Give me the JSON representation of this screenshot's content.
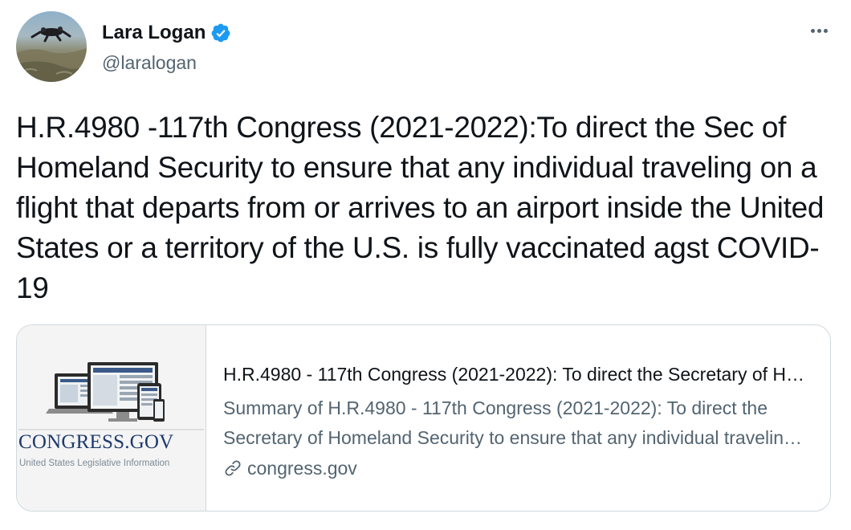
{
  "author": {
    "display_name": "Lara Logan",
    "handle": "@laralogan",
    "verified": true,
    "avatar_icon": "skydiver-photo"
  },
  "tweet": {
    "text": "H.R.4980 -117th Congress (2021-2022):To direct the Sec of Homeland Security to ensure that any individual traveling on a flight that departs from or arrives to an airport inside the United States or a territory of the U.S. is fully vaccinated agst COVID-19"
  },
  "card": {
    "title": "H.R.4980 - 117th Congress (2021-2022): To direct the Secretary of Homeland Security to ensure that any individual traveling on a flight",
    "description": "Summary of H.R.4980 - 117th Congress (2021-2022): To direct the Secretary of Homeland Security to ensure that any individual traveling on a flight that departs from or arrives to an airport",
    "domain": "congress.gov",
    "image": {
      "logo_text": "CONGRESS.GOV",
      "logo_subtext": "United States Legislative Information"
    }
  },
  "icons": {
    "more": "more-horizontal-icon",
    "verified": "verified-badge-icon",
    "link": "link-icon"
  },
  "colors": {
    "text_primary": "#0f1419",
    "text_secondary": "#536471",
    "verified_blue": "#1d9bf0",
    "border": "#cfd9de",
    "logo_blue": "#1d3a6e"
  }
}
